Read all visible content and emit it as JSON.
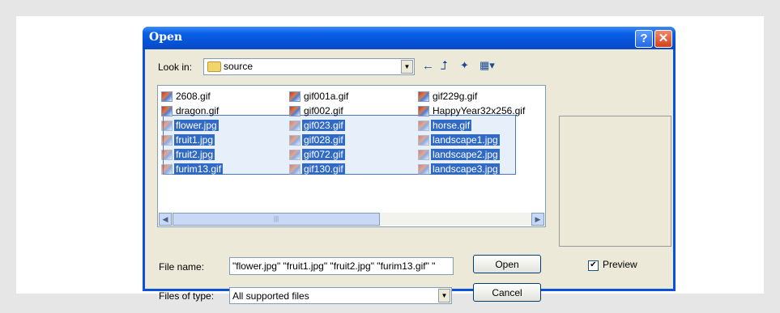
{
  "dialog": {
    "title": "Open",
    "help_label": "?",
    "close_label": "✕",
    "look_in_label": "Look in:",
    "look_in_value": "source",
    "file_name_label": "File name:",
    "file_name_value": "\"flower.jpg\" \"fruit1.jpg\" \"fruit2.jpg\" \"furim13.gif\" \"",
    "files_of_type_label": "Files of type:",
    "files_of_type_value": "All supported files",
    "open_button": "Open",
    "cancel_button": "Cancel",
    "preview_label": "Preview",
    "preview_checked": true
  },
  "toolbar": {
    "back_icon": "←",
    "up_icon": "⮥",
    "new_folder_icon": "✦",
    "view_icon": "▦▾"
  },
  "files": {
    "col1": [
      "2608.gif",
      "dragon.gif",
      "flower.jpg",
      "fruit1.jpg",
      "fruit2.jpg",
      "furim13.gif"
    ],
    "col2": [
      "gif001a.gif",
      "gif002.gif",
      "gif023.gif",
      "gif028.gif",
      "gif072.gif",
      "gif130.gif"
    ],
    "col3": [
      "gif229g.gif",
      "HappyYear32x256.gif",
      "horse.gif",
      "landscape1.jpg",
      "landscape2.jpg",
      "landscape3.jpg"
    ],
    "selected_start_row": 2
  },
  "colors": {
    "selection": "#316ac5",
    "titlebar": "#0553d6"
  }
}
